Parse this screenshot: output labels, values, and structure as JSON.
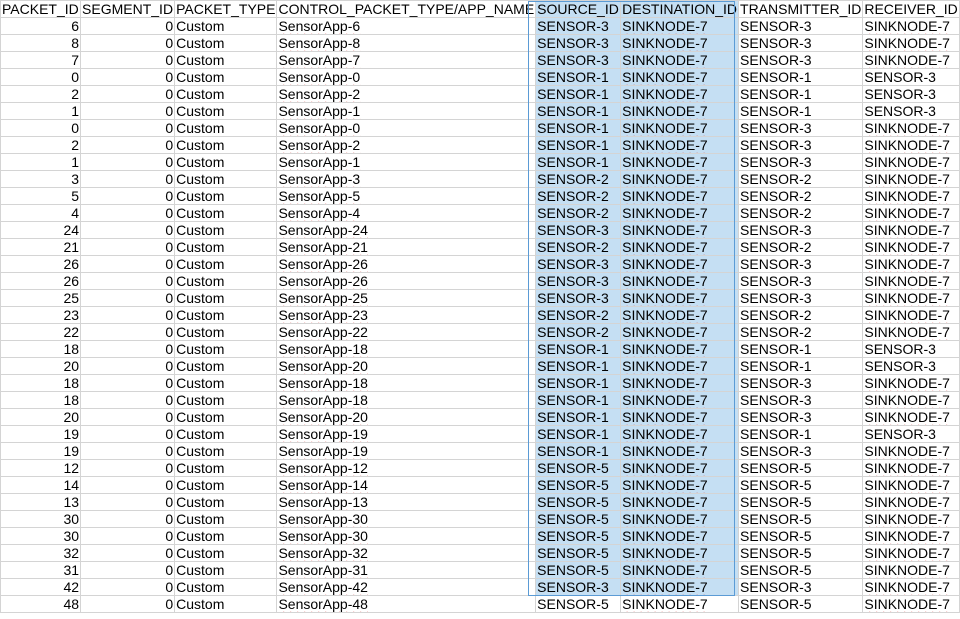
{
  "columns": [
    "PACKET_ID",
    "SEGMENT_ID",
    "PACKET_TYPE",
    "CONTROL_PACKET_TYPE/APP_NAME",
    "SOURCE_ID",
    "DESTINATION_ID",
    "TRANSMITTER_ID",
    "RECEIVER_ID"
  ],
  "rows": [
    [
      "6",
      "0",
      "Custom",
      "SensorApp-6",
      "SENSOR-3",
      "SINKNODE-7",
      "SENSOR-3",
      "SINKNODE-7"
    ],
    [
      "8",
      "0",
      "Custom",
      "SensorApp-8",
      "SENSOR-3",
      "SINKNODE-7",
      "SENSOR-3",
      "SINKNODE-7"
    ],
    [
      "7",
      "0",
      "Custom",
      "SensorApp-7",
      "SENSOR-3",
      "SINKNODE-7",
      "SENSOR-3",
      "SINKNODE-7"
    ],
    [
      "0",
      "0",
      "Custom",
      "SensorApp-0",
      "SENSOR-1",
      "SINKNODE-7",
      "SENSOR-1",
      "SENSOR-3"
    ],
    [
      "2",
      "0",
      "Custom",
      "SensorApp-2",
      "SENSOR-1",
      "SINKNODE-7",
      "SENSOR-1",
      "SENSOR-3"
    ],
    [
      "1",
      "0",
      "Custom",
      "SensorApp-1",
      "SENSOR-1",
      "SINKNODE-7",
      "SENSOR-1",
      "SENSOR-3"
    ],
    [
      "0",
      "0",
      "Custom",
      "SensorApp-0",
      "SENSOR-1",
      "SINKNODE-7",
      "SENSOR-3",
      "SINKNODE-7"
    ],
    [
      "2",
      "0",
      "Custom",
      "SensorApp-2",
      "SENSOR-1",
      "SINKNODE-7",
      "SENSOR-3",
      "SINKNODE-7"
    ],
    [
      "1",
      "0",
      "Custom",
      "SensorApp-1",
      "SENSOR-1",
      "SINKNODE-7",
      "SENSOR-3",
      "SINKNODE-7"
    ],
    [
      "3",
      "0",
      "Custom",
      "SensorApp-3",
      "SENSOR-2",
      "SINKNODE-7",
      "SENSOR-2",
      "SINKNODE-7"
    ],
    [
      "5",
      "0",
      "Custom",
      "SensorApp-5",
      "SENSOR-2",
      "SINKNODE-7",
      "SENSOR-2",
      "SINKNODE-7"
    ],
    [
      "4",
      "0",
      "Custom",
      "SensorApp-4",
      "SENSOR-2",
      "SINKNODE-7",
      "SENSOR-2",
      "SINKNODE-7"
    ],
    [
      "24",
      "0",
      "Custom",
      "SensorApp-24",
      "SENSOR-3",
      "SINKNODE-7",
      "SENSOR-3",
      "SINKNODE-7"
    ],
    [
      "21",
      "0",
      "Custom",
      "SensorApp-21",
      "SENSOR-2",
      "SINKNODE-7",
      "SENSOR-2",
      "SINKNODE-7"
    ],
    [
      "26",
      "0",
      "Custom",
      "SensorApp-26",
      "SENSOR-3",
      "SINKNODE-7",
      "SENSOR-3",
      "SINKNODE-7"
    ],
    [
      "26",
      "0",
      "Custom",
      "SensorApp-26",
      "SENSOR-3",
      "SINKNODE-7",
      "SENSOR-3",
      "SINKNODE-7"
    ],
    [
      "25",
      "0",
      "Custom",
      "SensorApp-25",
      "SENSOR-3",
      "SINKNODE-7",
      "SENSOR-3",
      "SINKNODE-7"
    ],
    [
      "23",
      "0",
      "Custom",
      "SensorApp-23",
      "SENSOR-2",
      "SINKNODE-7",
      "SENSOR-2",
      "SINKNODE-7"
    ],
    [
      "22",
      "0",
      "Custom",
      "SensorApp-22",
      "SENSOR-2",
      "SINKNODE-7",
      "SENSOR-2",
      "SINKNODE-7"
    ],
    [
      "18",
      "0",
      "Custom",
      "SensorApp-18",
      "SENSOR-1",
      "SINKNODE-7",
      "SENSOR-1",
      "SENSOR-3"
    ],
    [
      "20",
      "0",
      "Custom",
      "SensorApp-20",
      "SENSOR-1",
      "SINKNODE-7",
      "SENSOR-1",
      "SENSOR-3"
    ],
    [
      "18",
      "0",
      "Custom",
      "SensorApp-18",
      "SENSOR-1",
      "SINKNODE-7",
      "SENSOR-3",
      "SINKNODE-7"
    ],
    [
      "18",
      "0",
      "Custom",
      "SensorApp-18",
      "SENSOR-1",
      "SINKNODE-7",
      "SENSOR-3",
      "SINKNODE-7"
    ],
    [
      "20",
      "0",
      "Custom",
      "SensorApp-20",
      "SENSOR-1",
      "SINKNODE-7",
      "SENSOR-3",
      "SINKNODE-7"
    ],
    [
      "19",
      "0",
      "Custom",
      "SensorApp-19",
      "SENSOR-1",
      "SINKNODE-7",
      "SENSOR-1",
      "SENSOR-3"
    ],
    [
      "19",
      "0",
      "Custom",
      "SensorApp-19",
      "SENSOR-1",
      "SINKNODE-7",
      "SENSOR-3",
      "SINKNODE-7"
    ],
    [
      "12",
      "0",
      "Custom",
      "SensorApp-12",
      "SENSOR-5",
      "SINKNODE-7",
      "SENSOR-5",
      "SINKNODE-7"
    ],
    [
      "14",
      "0",
      "Custom",
      "SensorApp-14",
      "SENSOR-5",
      "SINKNODE-7",
      "SENSOR-5",
      "SINKNODE-7"
    ],
    [
      "13",
      "0",
      "Custom",
      "SensorApp-13",
      "SENSOR-5",
      "SINKNODE-7",
      "SENSOR-5",
      "SINKNODE-7"
    ],
    [
      "30",
      "0",
      "Custom",
      "SensorApp-30",
      "SENSOR-5",
      "SINKNODE-7",
      "SENSOR-5",
      "SINKNODE-7"
    ],
    [
      "30",
      "0",
      "Custom",
      "SensorApp-30",
      "SENSOR-5",
      "SINKNODE-7",
      "SENSOR-5",
      "SINKNODE-7"
    ],
    [
      "32",
      "0",
      "Custom",
      "SensorApp-32",
      "SENSOR-5",
      "SINKNODE-7",
      "SENSOR-5",
      "SINKNODE-7"
    ],
    [
      "31",
      "0",
      "Custom",
      "SensorApp-31",
      "SENSOR-5",
      "SINKNODE-7",
      "SENSOR-5",
      "SINKNODE-7"
    ],
    [
      "42",
      "0",
      "Custom",
      "SensorApp-42",
      "SENSOR-3",
      "SINKNODE-7",
      "SENSOR-3",
      "SINKNODE-7"
    ],
    [
      "48",
      "0",
      "Custom",
      "SensorApp-48",
      "SENSOR-5",
      "SINKNODE-7",
      "SENSOR-5",
      "SINKNODE-7"
    ]
  ],
  "selected_columns": [
    "SOURCE_ID",
    "DESTINATION_ID"
  ],
  "selected_row_count": 34,
  "spellcheck_flagged_columns": [
    "CONTROL_PACKET_TYPE/APP_NAME",
    "DESTINATION_ID",
    "RECEIVER_ID"
  ],
  "colors": {
    "selection_fill": "#c5dff3",
    "selection_border": "#5b9bd5",
    "gridline": "#d4d4d4",
    "spellcheck": "#e03030"
  }
}
